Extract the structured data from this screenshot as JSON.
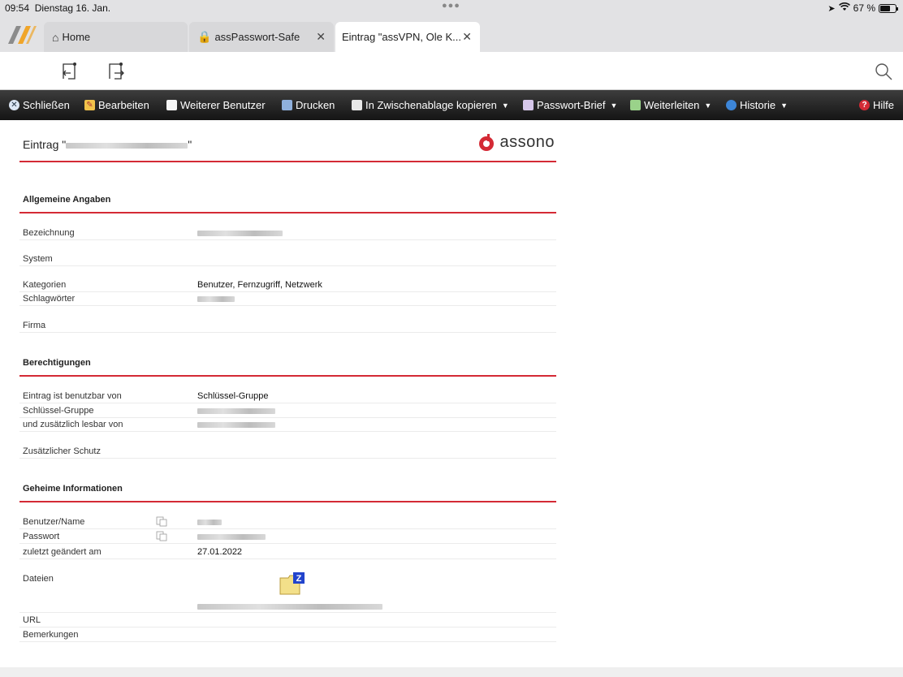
{
  "status": {
    "time": "09:54",
    "date": "Dienstag 16. Jan.",
    "battery": "67 %"
  },
  "tabs": [
    {
      "label": "Home",
      "icon": "home-icon"
    },
    {
      "label": "assPasswort-Safe",
      "icon": "safe-icon"
    },
    {
      "label": "Eintrag \"assVPN, Ole K...",
      "icon": ""
    }
  ],
  "menu": [
    {
      "label": "Schließen",
      "icon": "close-circle-icon"
    },
    {
      "label": "Bearbeiten",
      "icon": "edit-icon"
    },
    {
      "label": "Weiterer Benutzer",
      "icon": "document-icon"
    },
    {
      "label": "Drucken",
      "icon": "print-icon"
    },
    {
      "label": "In Zwischenablage kopieren",
      "icon": "copy-icon"
    },
    {
      "label": "Passwort-Brief",
      "icon": "letter-icon"
    },
    {
      "label": "Weiterleiten",
      "icon": "forward-icon"
    },
    {
      "label": "Historie",
      "icon": "history-icon"
    },
    {
      "label": "Hilfe",
      "icon": "help-icon"
    }
  ],
  "entry": {
    "title_prefix": "Eintrag \"",
    "title_suffix": "\"",
    "brand": "assono"
  },
  "sections": {
    "general": "Allgemeine Angaben",
    "permissions": "Berechtigungen",
    "secret": "Geheime Informationen"
  },
  "fields": {
    "bezeichnung": "Bezeichnung",
    "system": "System",
    "kategorien": "Kategorien",
    "kategorien_value": "Benutzer, Fernzugriff, Netzwerk",
    "schlagwoerter": "Schlagwörter",
    "firma": "Firma",
    "benutzbar": "Eintrag ist benutzbar von",
    "benutzbar_value": "Schlüssel-Gruppe",
    "schluessel": "Schlüssel-Gruppe",
    "lesbar": "und zusätzlich lesbar von",
    "schutz": "Zusätzlicher Schutz",
    "benutzer": "Benutzer/Name",
    "passwort": "Passwort",
    "geaendert": "zuletzt geändert am",
    "geaendert_value": "27.01.2022",
    "dateien": "Dateien",
    "url": "URL",
    "bemerkungen": "Bemerkungen"
  },
  "colors": {
    "accent": "#d42a35",
    "menubar": "#1e1e1e"
  }
}
